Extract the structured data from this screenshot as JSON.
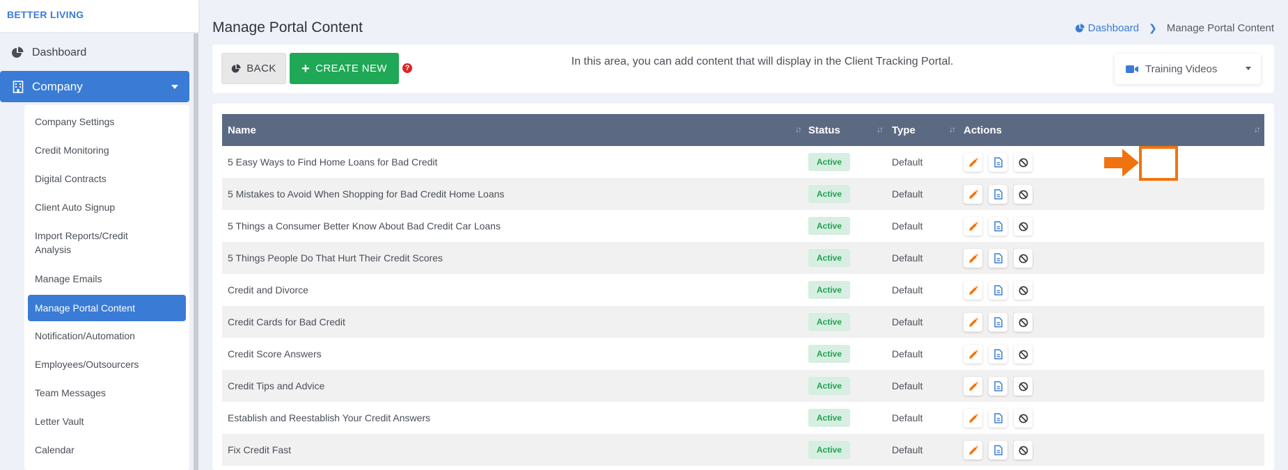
{
  "brand": "BETTER LIVING",
  "sidebar": {
    "dashboard_label": "Dashboard",
    "company_label": "Company",
    "submenu": [
      "Company Settings",
      "Credit Monitoring",
      "Digital Contracts",
      "Client Auto Signup",
      "Import Reports/Credit Analysis",
      "Manage Emails",
      "Manage Portal Content",
      "Notification/Automation",
      "Employees/Outsourcers",
      "Team Messages",
      "Letter Vault",
      "Calendar"
    ],
    "active_item": "Manage Portal Content"
  },
  "header": {
    "title": "Manage Portal Content",
    "breadcrumb": [
      "Dashboard",
      "Manage Portal Content"
    ]
  },
  "toolbar": {
    "back_label": "BACK",
    "create_label": "CREATE NEW",
    "info_text": "In this area, you can add content that will display in the Client Tracking Portal.",
    "select_value": "Training Videos"
  },
  "table": {
    "columns": [
      "Name",
      "Status",
      "Type",
      "Actions"
    ],
    "rows": [
      {
        "name": "5 Easy Ways to Find Home Loans for Bad Credit",
        "status": "Active",
        "type": "Default"
      },
      {
        "name": "5 Mistakes to Avoid When Shopping for Bad Credit Home Loans",
        "status": "Active",
        "type": "Default"
      },
      {
        "name": "5 Things a Consumer Better Know About Bad Credit Car Loans",
        "status": "Active",
        "type": "Default"
      },
      {
        "name": "5 Things People Do That Hurt Their Credit Scores",
        "status": "Active",
        "type": "Default"
      },
      {
        "name": "Credit and Divorce",
        "status": "Active",
        "type": "Default"
      },
      {
        "name": "Credit Cards for Bad Credit",
        "status": "Active",
        "type": "Default"
      },
      {
        "name": "Credit Score Answers",
        "status": "Active",
        "type": "Default"
      },
      {
        "name": "Credit Tips and Advice",
        "status": "Active",
        "type": "Default"
      },
      {
        "name": "Establish and Reestablish Your Credit Answers",
        "status": "Active",
        "type": "Default"
      },
      {
        "name": "Fix Credit Fast",
        "status": "Active",
        "type": "Default"
      }
    ]
  },
  "colors": {
    "primary": "#3a7bd5",
    "success": "#1fa855",
    "header_bg": "#5b6a82",
    "edit_icon": "#f0730f",
    "annotation": "#f0730f"
  },
  "icons": {
    "edit": "pencil-icon",
    "view": "document-icon",
    "disable": "ban-icon"
  }
}
